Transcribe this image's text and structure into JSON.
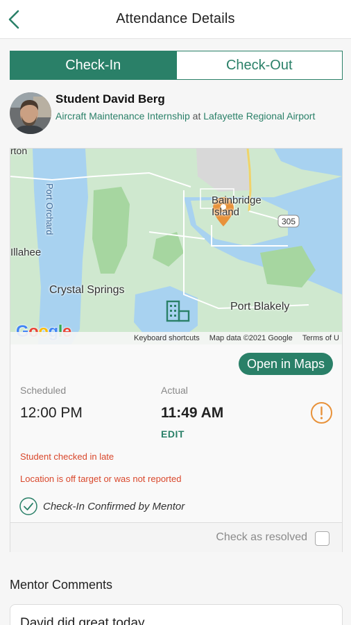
{
  "header": {
    "title": "Attendance Details",
    "back_icon": "chevron-left-icon"
  },
  "tabs": [
    {
      "label": "Check-In",
      "active": true
    },
    {
      "label": "Check-Out",
      "active": false
    }
  ],
  "student": {
    "name": "Student David Berg",
    "program": "Aircraft Maintenance Internship",
    "connector": "at",
    "location": "Lafayette Regional Airport"
  },
  "map": {
    "labels": {
      "orton": "rton",
      "port_orchard": "Port Orchard",
      "illahee": "Illahee",
      "bainbridge": "Bainbridge Island",
      "crystal_springs": "Crystal Springs",
      "port_blakely": "Port Blakely",
      "route": "305"
    },
    "logo": "Google",
    "footer": {
      "shortcuts": "Keyboard shortcuts",
      "data": "Map data ©2021 Google",
      "terms": "Terms of U"
    },
    "colors": {
      "water": "#a8d2f0",
      "land": "#cfe8cf",
      "park": "#a6d6a0",
      "pin": "#e8923a",
      "building": "#2a8068"
    }
  },
  "open_maps_label": "Open in Maps",
  "times": {
    "scheduled_label": "Scheduled",
    "scheduled_value": "12:00 PM",
    "actual_label": "Actual",
    "actual_value": "11:49 AM",
    "edit_label": "EDIT"
  },
  "alerts": {
    "late": "Student checked in late",
    "location": "Location is off target or was not reported"
  },
  "confirmation": "Check-In Confirmed by Mentor",
  "resolve_label": "Check as resolved",
  "mentor_comments": {
    "title": "Mentor Comments",
    "text": "David did great today"
  },
  "colors": {
    "accent": "#2a8068",
    "alert": "#d9472b",
    "warning": "#e8923a"
  }
}
